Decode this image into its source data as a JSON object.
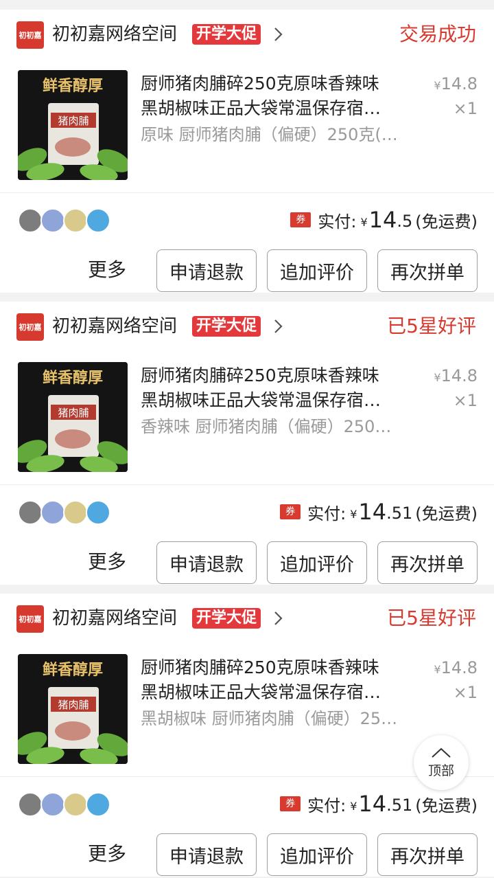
{
  "orders": [
    {
      "store": {
        "logo_text": "初初嘉",
        "name": "初初嘉网络空间",
        "promo": "开学大促"
      },
      "status": "交易成功",
      "product": {
        "title_line1": "厨师猪肉脯碎250克原味香辣味",
        "title_line2": "黑胡椒味正品大袋常温保存宿…",
        "sku": "原味 厨师猪肉脯（偏硬）250克(…",
        "price_symbol": "¥",
        "price": "14.8",
        "quantity": "×1",
        "image_text": {
          "top": "鲜香醇厚",
          "pack": "猪肉脯"
        }
      },
      "payment": {
        "coupon": "券",
        "label": "实付:",
        "currency": "¥",
        "amount_int": "14",
        "amount_dec": ".5",
        "note": "(免运费)"
      },
      "actions": {
        "more": "更多",
        "refund": "申请退款",
        "review": "追加评价",
        "rebuy": "再次拼单"
      }
    },
    {
      "store": {
        "logo_text": "初初嘉",
        "name": "初初嘉网络空间",
        "promo": "开学大促"
      },
      "status": "已5星好评",
      "product": {
        "title_line1": "厨师猪肉脯碎250克原味香辣味",
        "title_line2": "黑胡椒味正品大袋常温保存宿…",
        "sku": "香辣味 厨师猪肉脯（偏硬）250…",
        "price_symbol": "¥",
        "price": "14.8",
        "quantity": "×1",
        "image_text": {
          "top": "鲜香醇厚",
          "pack": "猪肉脯"
        }
      },
      "payment": {
        "coupon": "券",
        "label": "实付:",
        "currency": "¥",
        "amount_int": "14",
        "amount_dec": ".51",
        "note": "(免运费)"
      },
      "actions": {
        "more": "更多",
        "refund": "申请退款",
        "review": "追加评价",
        "rebuy": "再次拼单"
      }
    },
    {
      "store": {
        "logo_text": "初初嘉",
        "name": "初初嘉网络空间",
        "promo": "开学大促"
      },
      "status": "已5星好评",
      "product": {
        "title_line1": "厨师猪肉脯碎250克原味香辣味",
        "title_line2": "黑胡椒味正品大袋常温保存宿…",
        "sku": "黑胡椒味 厨师猪肉脯（偏硬）25…",
        "price_symbol": "¥",
        "price": "14.8",
        "quantity": "×1",
        "image_text": {
          "top": "鲜香醇厚",
          "pack": "猪肉脯"
        }
      },
      "payment": {
        "coupon": "券",
        "label": "实付:",
        "currency": "¥",
        "amount_int": "14",
        "amount_dec": ".51",
        "note": "(免运费)"
      },
      "actions": {
        "more": "更多",
        "refund": "申请退款",
        "review": "追加评价",
        "rebuy": "再次拼单"
      }
    }
  ],
  "back_to_top": {
    "label": "顶部",
    "icon": "chevron-up-icon"
  },
  "colors": {
    "accent": "#e4393c",
    "status": "#d83a2f",
    "background": "#f2f2f2"
  }
}
